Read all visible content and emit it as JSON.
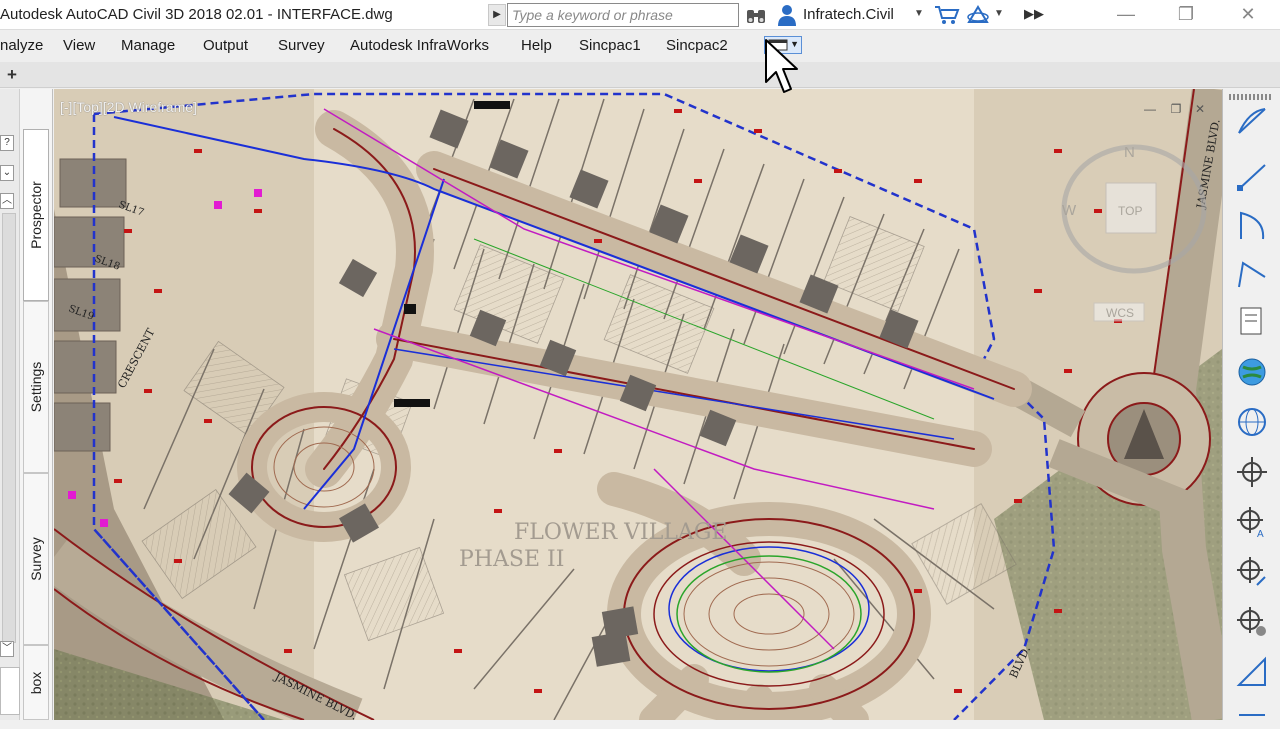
{
  "titlebar": {
    "app_title": "Autodesk AutoCAD Civil 3D 2018     02.01 - INTERFACE.dwg",
    "search_placeholder": "Type a keyword or phrase",
    "user_name": "Infratech.Civil"
  },
  "menu": {
    "items": [
      "nalyze",
      "View",
      "Manage",
      "Output",
      "Survey",
      "Autodesk InfraWorks",
      "Help",
      "Sincpac1",
      "Sincpac2"
    ]
  },
  "toolspace": {
    "tabs": [
      "Prospector",
      "Settings",
      "Survey",
      "box"
    ]
  },
  "viewport": {
    "label": "[-][Top][2D Wireframe]",
    "cube_top": "TOP",
    "cube_west": "W",
    "cube_north": "N",
    "wcs": "WCS"
  },
  "drawing": {
    "project_line1": "FLOWER VILLAGE",
    "project_line2": "PHASE II",
    "street_crescent": "CRESCENT",
    "street_jasmine_bottom": "JASMINE BLVD.",
    "street_jasmine_right": "JASMINE BLVD.",
    "street_blvd": "BLVD.",
    "lot_sl17": "SL17",
    "lot_sl18": "SL18",
    "lot_sl19": "SL19"
  },
  "colors": {
    "road_red": "#8b1a1a",
    "alignment_blue": "#1a2fd8",
    "boundary_blue": "#2233cc",
    "pipe_magenta": "#c21bc2",
    "grade_green": "#2aa52a"
  }
}
